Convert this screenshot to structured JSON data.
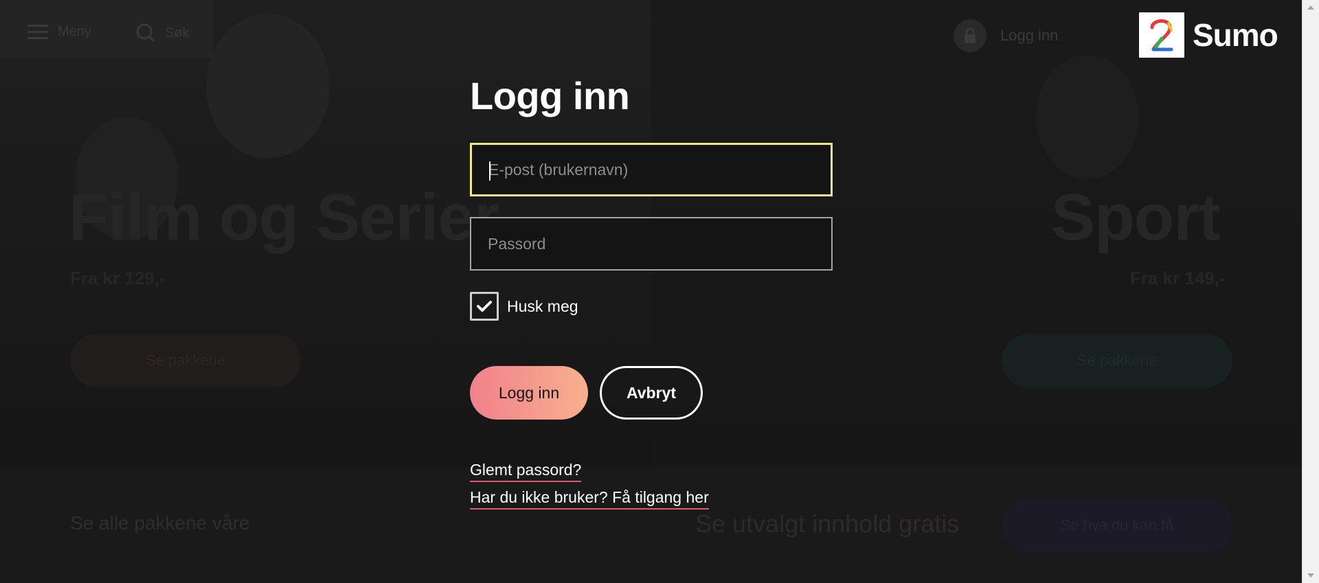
{
  "background": {
    "menu_label": "Meny",
    "search_label": "Søk",
    "login_label": "Logg inn",
    "left_hero": {
      "title": "Film og Serier",
      "price": "Fra kr 129,-",
      "button": "Se pakkene"
    },
    "right_hero": {
      "title": "Sport",
      "price": "Fra kr 149,-",
      "button": "Se pakkene"
    },
    "bottom_strip": {
      "all_packages": "Se alle pakkene våre",
      "free_content_prefix": "Se utvalgt innhold",
      "free_content_highlight": "gratis",
      "free_button": "Se hva du kan få"
    }
  },
  "logo": {
    "text": "Sumo",
    "badge": "2"
  },
  "dialog": {
    "title": "Logg inn",
    "email_placeholder": "E-post (brukernavn)",
    "password_placeholder": "Passord",
    "remember_label": "Husk meg",
    "remember_checked": true,
    "login_button": "Logg inn",
    "cancel_button": "Avbryt",
    "forgot_link": "Glemt passord?",
    "signup_link": "Har du ikke bruker? Få tilgang her"
  },
  "colors": {
    "focus_border": "#f4e98a",
    "primary_gradient_start": "#f0818c",
    "primary_gradient_end": "#f8b08e",
    "link_underline": "#e2586a"
  }
}
